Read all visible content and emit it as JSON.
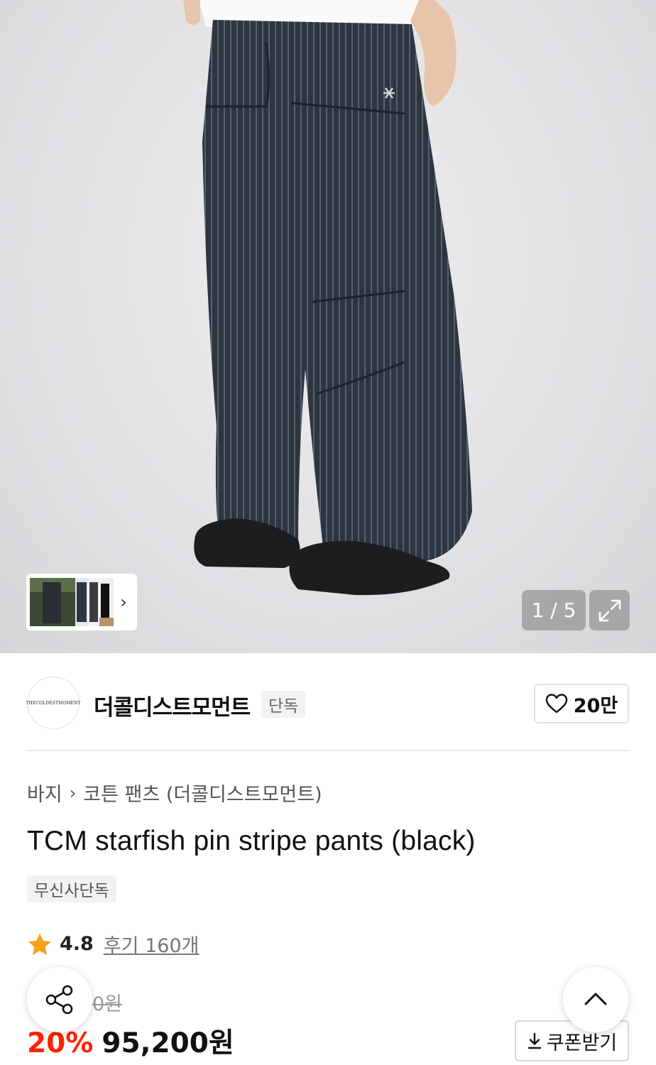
{
  "gallery": {
    "counter": "1 / 5",
    "thumb_next": "›"
  },
  "brand": {
    "logo_text": "THECOLDESTMOMENT",
    "name": "더콜디스트모먼트",
    "badge": "단독",
    "likes": "20만"
  },
  "breadcrumb": {
    "items": [
      "바지",
      "코튼 팬츠 (더콜디스트모먼트)"
    ],
    "separator": "›"
  },
  "product": {
    "title": "TCM starfish pin stripe pants (black)",
    "tag": "무신사단독",
    "rating": "4.8",
    "reviews": "후기 160개",
    "original_price_fragment": "0원",
    "discount": "20%",
    "price": "95,200원"
  },
  "actions": {
    "coupon_label": "쿠폰받기"
  },
  "colors": {
    "discount": "#ff2200",
    "star": "#f7a21b"
  },
  "icons": {
    "like": "heart-icon",
    "share": "share-icon",
    "scroll_top": "chevron-up-icon",
    "expand": "expand-icon",
    "coupon": "download-icon",
    "rating": "star-icon"
  }
}
